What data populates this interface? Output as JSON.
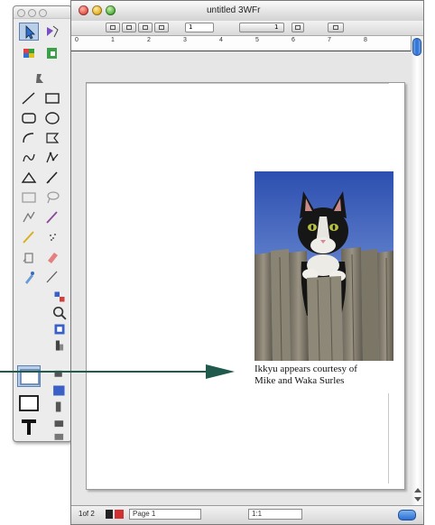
{
  "window": {
    "title": "untitled 3WFr"
  },
  "toolbar": {
    "page_field": "1",
    "page_total": "1"
  },
  "ruler": {
    "labels": [
      "0",
      "1",
      "2",
      "3",
      "4",
      "5",
      "6",
      "7",
      "8"
    ]
  },
  "page": {
    "caption_line1": "Ikkyu appears courtesy of",
    "caption_line2": "Mike and Waka Surles",
    "photo_subject": "cat-on-fence-painting"
  },
  "statusbar": {
    "page_indicator": "1of 2",
    "page_label": "Page 1",
    "zoom_field": "1:1"
  },
  "palette": {
    "tools": [
      "pointer-icon",
      "reshape-icon",
      "grid-icon",
      "puzzle-icon",
      "stamp-icon",
      "line-icon",
      "rectangle-icon",
      "rounded-rect-icon",
      "oval-icon",
      "arc-icon",
      "freeform-icon",
      "polygon-icon",
      "spline-icon",
      "triangle-icon",
      "pen-icon",
      "box-icon",
      "lasso-icon",
      "connector-icon",
      "brush-icon",
      "pencil-icon",
      "spray-icon",
      "bucket-icon",
      "eraser-icon",
      "eyedropper-icon",
      "knife-icon",
      "frame-tool-icon",
      "text-frame-icon",
      "text-tool-icon",
      "rotate-icon",
      "zoom-icon",
      "hand-icon",
      "measure-icon"
    ]
  },
  "colors": {
    "arrow": "#1f5a4c",
    "selection": "#5a7fb0",
    "scroll_accent": "#2c6fd4"
  }
}
